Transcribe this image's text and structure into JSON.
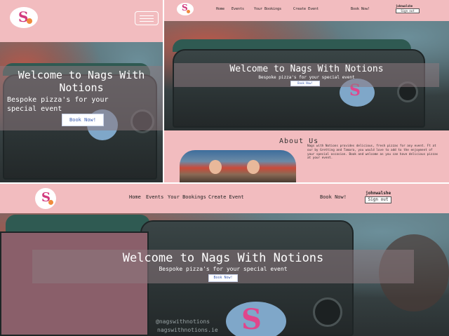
{
  "site": {
    "title": "Welcome to Nags With Notions",
    "subtitle": "Bespoke pizza's for your special event",
    "book_label": "Book Now!",
    "trailer_text_1": "@nagswithnotions",
    "trailer_text_2": "nagswithnotions.ie"
  },
  "nav": {
    "items": [
      {
        "label": "Home"
      },
      {
        "label": "Events"
      },
      {
        "label": "Your Bookings"
      },
      {
        "label": "Create Event"
      }
    ],
    "book_label": "Book Now!",
    "username": "johnwalshe",
    "signout_label": "Sign out"
  },
  "about": {
    "heading": "About Us",
    "text": "Nags with Notions provides delicious, fresh pizzas for any event. Ft at our by Gretting and Tamara, you would love to add to the enjoyment of your special occasion. Book and welcome as you can have delicious pizzas at your event."
  },
  "colors": {
    "page_bg": "#f2bcbf",
    "button_text": "#3a5bb0",
    "brand_pink": "#d23a7e"
  }
}
